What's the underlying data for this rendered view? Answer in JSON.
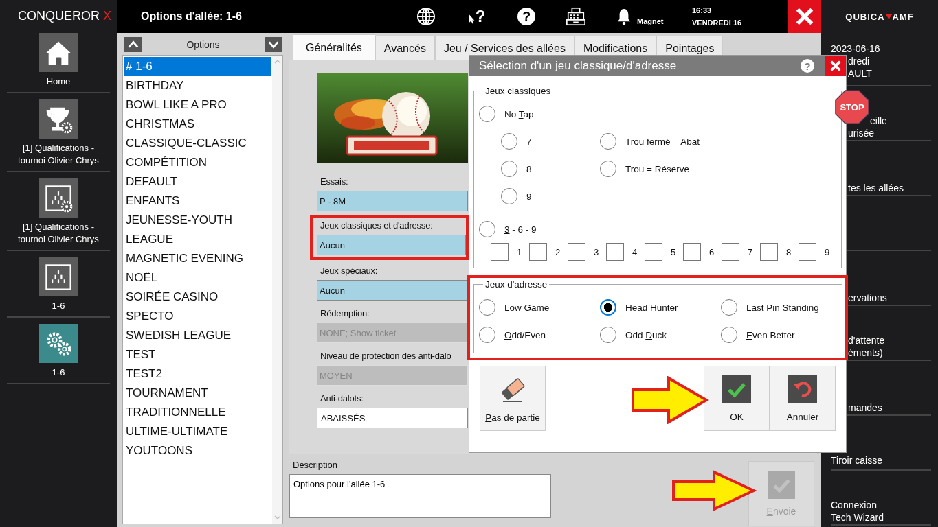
{
  "brand": {
    "name": "CONQUEROR",
    "mark": "X"
  },
  "nav": [
    {
      "kind": "home",
      "label": "Home",
      "selected": false
    },
    {
      "kind": "trophy",
      "label": "[1] Qualifications - tournoi Olivier Chrys",
      "selected": false
    },
    {
      "kind": "pins-gear",
      "label": "[1] Qualifications - tournoi Olivier Chrys",
      "selected": false
    },
    {
      "kind": "pins",
      "label": "1-6",
      "selected": false
    },
    {
      "kind": "gears",
      "label": "1-6",
      "selected": true
    }
  ],
  "header": {
    "title": "Options d'allée: 1-6",
    "pointer_glyph": "?",
    "help_glyph": "?",
    "user": "Magnet",
    "time": "16:33",
    "date": "VENDREDI 16"
  },
  "vendor": {
    "left": "QUBICA",
    "right": "AMF"
  },
  "right_menu": [
    {
      "kind": "date",
      "lines": [
        {
          "text": "2023-06-16",
          "kind": "full"
        },
        {
          "text": "dredi",
          "kind": "cut"
        },
        {
          "text": "AULT",
          "kind": "cut"
        }
      ]
    },
    {
      "kind": "entry",
      "lines": [
        {
          "text": "eille",
          "kind": "behind-sign"
        },
        {
          "text": "urisée",
          "kind": "cut"
        }
      ]
    },
    {
      "kind": "entry",
      "lines": [
        {
          "text": "tes les allées",
          "kind": "cut"
        }
      ]
    },
    {
      "kind": "blank"
    },
    {
      "kind": "entry",
      "lines": [
        {
          "text": "ervations",
          "kind": "cut"
        }
      ]
    },
    {
      "kind": "entry",
      "lines": [
        {
          "text": "d'attente",
          "kind": "cut"
        },
        {
          "text": "éments)",
          "kind": "cut"
        }
      ]
    },
    {
      "kind": "entry",
      "lines": [
        {
          "text": "mandes",
          "kind": "cut"
        }
      ]
    },
    {
      "kind": "entry",
      "lines": [
        {
          "text": "Tiroir caisse",
          "kind": "full"
        }
      ]
    },
    {
      "kind": "entry",
      "lines": [
        {
          "text": "Connexion",
          "kind": "full"
        },
        {
          "text": "Tech Wizard",
          "kind": "full"
        }
      ]
    }
  ],
  "options_panel": {
    "title": "Options",
    "items": [
      {
        "label": "# 1-6",
        "selected": true
      },
      {
        "label": "BIRTHDAY",
        "selected": false
      },
      {
        "label": "BOWL LIKE A PRO",
        "selected": false
      },
      {
        "label": "CHRISTMAS",
        "selected": false
      },
      {
        "label": "CLASSIQUE-CLASSIC",
        "selected": false
      },
      {
        "label": "COMPÉTITION",
        "selected": false
      },
      {
        "label": "DEFAULT",
        "selected": false
      },
      {
        "label": "ENFANTS",
        "selected": false
      },
      {
        "label": "JEUNESSE-YOUTH",
        "selected": false
      },
      {
        "label": "LEAGUE",
        "selected": false
      },
      {
        "label": "MAGNETIC EVENING",
        "selected": false
      },
      {
        "label": "NOËL",
        "selected": false
      },
      {
        "label": "SOIRÉE CASINO",
        "selected": false
      },
      {
        "label": "SPECTO",
        "selected": false
      },
      {
        "label": "SWEDISH LEAGUE",
        "selected": false
      },
      {
        "label": "TEST",
        "selected": false
      },
      {
        "label": "TEST2",
        "selected": false
      },
      {
        "label": "TOURNAMENT",
        "selected": false
      },
      {
        "label": "TRADITIONNELLE",
        "selected": false
      },
      {
        "label": "ULTIME-ULTIMATE",
        "selected": false
      },
      {
        "label": "YOUTOONS",
        "selected": false
      }
    ]
  },
  "tabs": [
    {
      "label": "Généralités",
      "selected": true
    },
    {
      "label": "Avancés",
      "selected": false
    },
    {
      "label": "Jeu / Services des allées",
      "selected": false
    },
    {
      "label": "Modifications",
      "selected": false
    },
    {
      "label": "Pointages",
      "selected": false
    }
  ],
  "form": {
    "fields": [
      {
        "label": "Essais:",
        "value": "P - 8M",
        "kind": "picker",
        "highlighted": false
      },
      {
        "label": "Jeux classiques et d'adresse:",
        "value": "Aucun",
        "kind": "picker",
        "highlighted": true
      },
      {
        "label": "Jeux spéciaux:",
        "value": "Aucun",
        "kind": "picker",
        "highlighted": false
      },
      {
        "label": "Rédemption:",
        "value": "NONE; Show ticket",
        "kind": "locked",
        "highlighted": false
      },
      {
        "label": "Niveau de protection des anti-dalo",
        "value": "MOYEN",
        "kind": "locked",
        "highlighted": false
      },
      {
        "label": "Anti-dalots:",
        "value": "ABAISSÉS",
        "kind": "dropdown",
        "highlighted": false
      }
    ]
  },
  "description": {
    "label": {
      "key": "D",
      "post": "escription"
    },
    "value": "Options pour l'allée 1-6"
  },
  "send_button": {
    "label": {
      "key": "E",
      "post": "nvoie"
    },
    "disabled": true,
    "pointed": true
  },
  "dialog": {
    "title": "Sélection d'un jeu classique/d'adresse",
    "help_glyph": "?",
    "stop_sign": "STOP",
    "classic": {
      "legend": "Jeux classiques",
      "no_tap": {
        "label": {
          "pre": "No ",
          "key": "T",
          "post": "ap"
        },
        "selected": false
      },
      "no_tap_pins": [
        {
          "label": {
            "pre": "7"
          },
          "selected": false
        },
        {
          "label": {
            "pre": "8"
          },
          "selected": false
        },
        {
          "label": {
            "pre": "9"
          },
          "selected": false
        }
      ],
      "no_tap_modes": [
        {
          "label": {
            "pre": "Trou fermé = Abat"
          },
          "selected": false
        },
        {
          "label": {
            "pre": "Trou = Réserve"
          },
          "selected": false
        }
      ],
      "three_six_nine": {
        "label": {
          "key": "3",
          "post": " - 6 - 9"
        },
        "selected": false
      },
      "pins": [
        {
          "label": "1",
          "checked": false
        },
        {
          "label": "2",
          "checked": false
        },
        {
          "label": "3",
          "checked": false
        },
        {
          "label": "4",
          "checked": false
        },
        {
          "label": "5",
          "checked": false
        },
        {
          "label": "6",
          "checked": false
        },
        {
          "label": "7",
          "checked": false
        },
        {
          "label": "8",
          "checked": false
        },
        {
          "label": "9",
          "checked": false
        }
      ]
    },
    "address": {
      "legend": "Jeux d'adresse",
      "highlighted": true,
      "options": [
        {
          "label": {
            "key": "L",
            "post": "ow Game"
          },
          "selected": false
        },
        {
          "label": {
            "key": "H",
            "post": "ead Hunter"
          },
          "selected": true
        },
        {
          "label": {
            "pre": "Last ",
            "key": "P",
            "post": "in Standing"
          },
          "selected": false
        },
        {
          "label": {
            "key": "O",
            "post": "dd/Even"
          },
          "selected": false
        },
        {
          "label": {
            "pre": "Odd ",
            "key": "D",
            "post": "uck"
          },
          "selected": false
        },
        {
          "label": {
            "key": "E",
            "post": "ven Better"
          },
          "selected": false
        }
      ]
    },
    "buttons": [
      {
        "kind": "erase",
        "label": {
          "key": "P",
          "post": "as de partie"
        },
        "pointed": false
      },
      {
        "kind": "ok",
        "label": {
          "key": "O",
          "post": "K"
        },
        "pointed": true
      },
      {
        "kind": "cancel",
        "label": {
          "key": "A",
          "post": "nnuler"
        },
        "pointed": false
      }
    ]
  }
}
